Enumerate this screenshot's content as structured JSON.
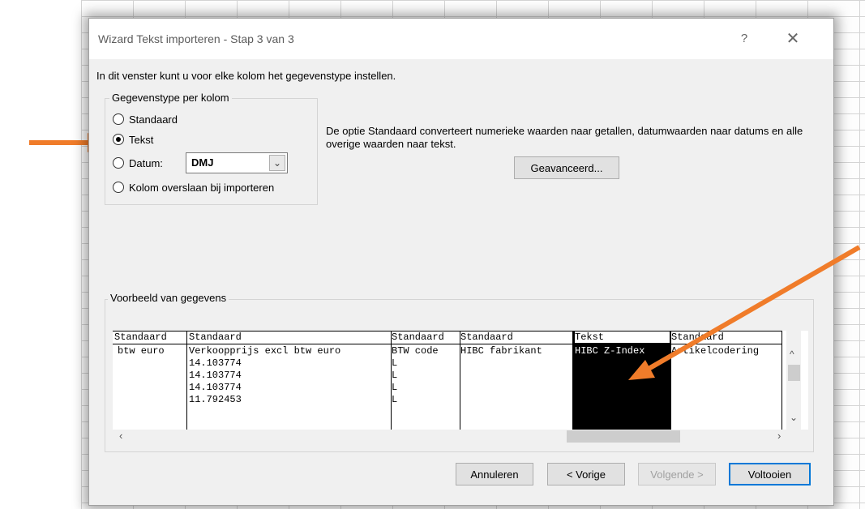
{
  "window": {
    "title": "Wizard Tekst importeren - Stap 3 van 3",
    "help": "?",
    "close": "✕"
  },
  "intro": "In dit venster kunt u voor elke kolom het gegevenstype instellen.",
  "column_type_group": {
    "legend": "Gegevenstype per kolom",
    "options": [
      {
        "label": "Standaard",
        "selected": false
      },
      {
        "label": "Tekst",
        "selected": true
      },
      {
        "label": "Datum:",
        "selected": false
      },
      {
        "label": "Kolom overslaan bij importeren",
        "selected": false
      }
    ],
    "date_format": "DMJ"
  },
  "description": "De optie Standaard converteert numerieke waarden naar getallen, datumwaarden naar datums en alle overige waarden naar tekst.",
  "advanced_button": "Geavanceerd...",
  "preview": {
    "legend": "Voorbeeld van gegevens",
    "columns": [
      {
        "type": "Standaard",
        "cells": [
          "btw euro",
          "",
          "",
          "",
          ""
        ]
      },
      {
        "type": "Standaard",
        "cells": [
          "Verkoopprijs excl btw euro",
          "14.103774",
          "14.103774",
          "14.103774",
          "11.792453"
        ]
      },
      {
        "type": "Standaard",
        "cells": [
          "BTW code",
          "L",
          "L",
          "L",
          "L"
        ]
      },
      {
        "type": "Standaard",
        "cells": [
          "HIBC fabrikant",
          "",
          "",
          "",
          ""
        ]
      },
      {
        "type": "Tekst",
        "cells": [
          "HIBC Z-Index",
          "",
          "",
          "",
          ""
        ],
        "selected": true
      },
      {
        "type": "Standaard",
        "cells": [
          "Artikelcodering",
          "",
          "",
          "",
          ""
        ]
      }
    ]
  },
  "buttons": {
    "cancel": "Annuleren",
    "back": "< Vorige",
    "next": "Volgende >",
    "finish": "Voltooien"
  },
  "colors": {
    "annotation_arrow": "#f07c2a",
    "selected_column": "#000000",
    "default_button_border": "#0078d7"
  }
}
